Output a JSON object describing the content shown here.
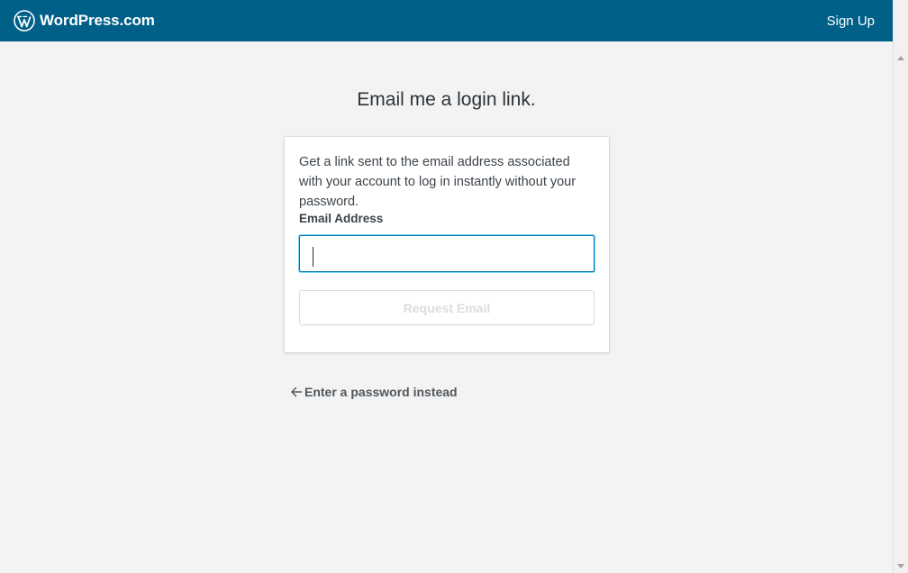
{
  "header": {
    "brand": "WordPress.com",
    "brand_icon": "wordpress-logo-icon",
    "signup_label": "Sign Up",
    "background_color": "#006088"
  },
  "main": {
    "heading": "Email me a login link.",
    "description": "Get a link sent to the email address associated with your account to log in instantly without your password.",
    "email_label": "Email Address",
    "email_value": "",
    "request_button_label": "Request Email",
    "back_link_label": "Enter a password instead",
    "back_icon": "arrow-left-icon"
  }
}
